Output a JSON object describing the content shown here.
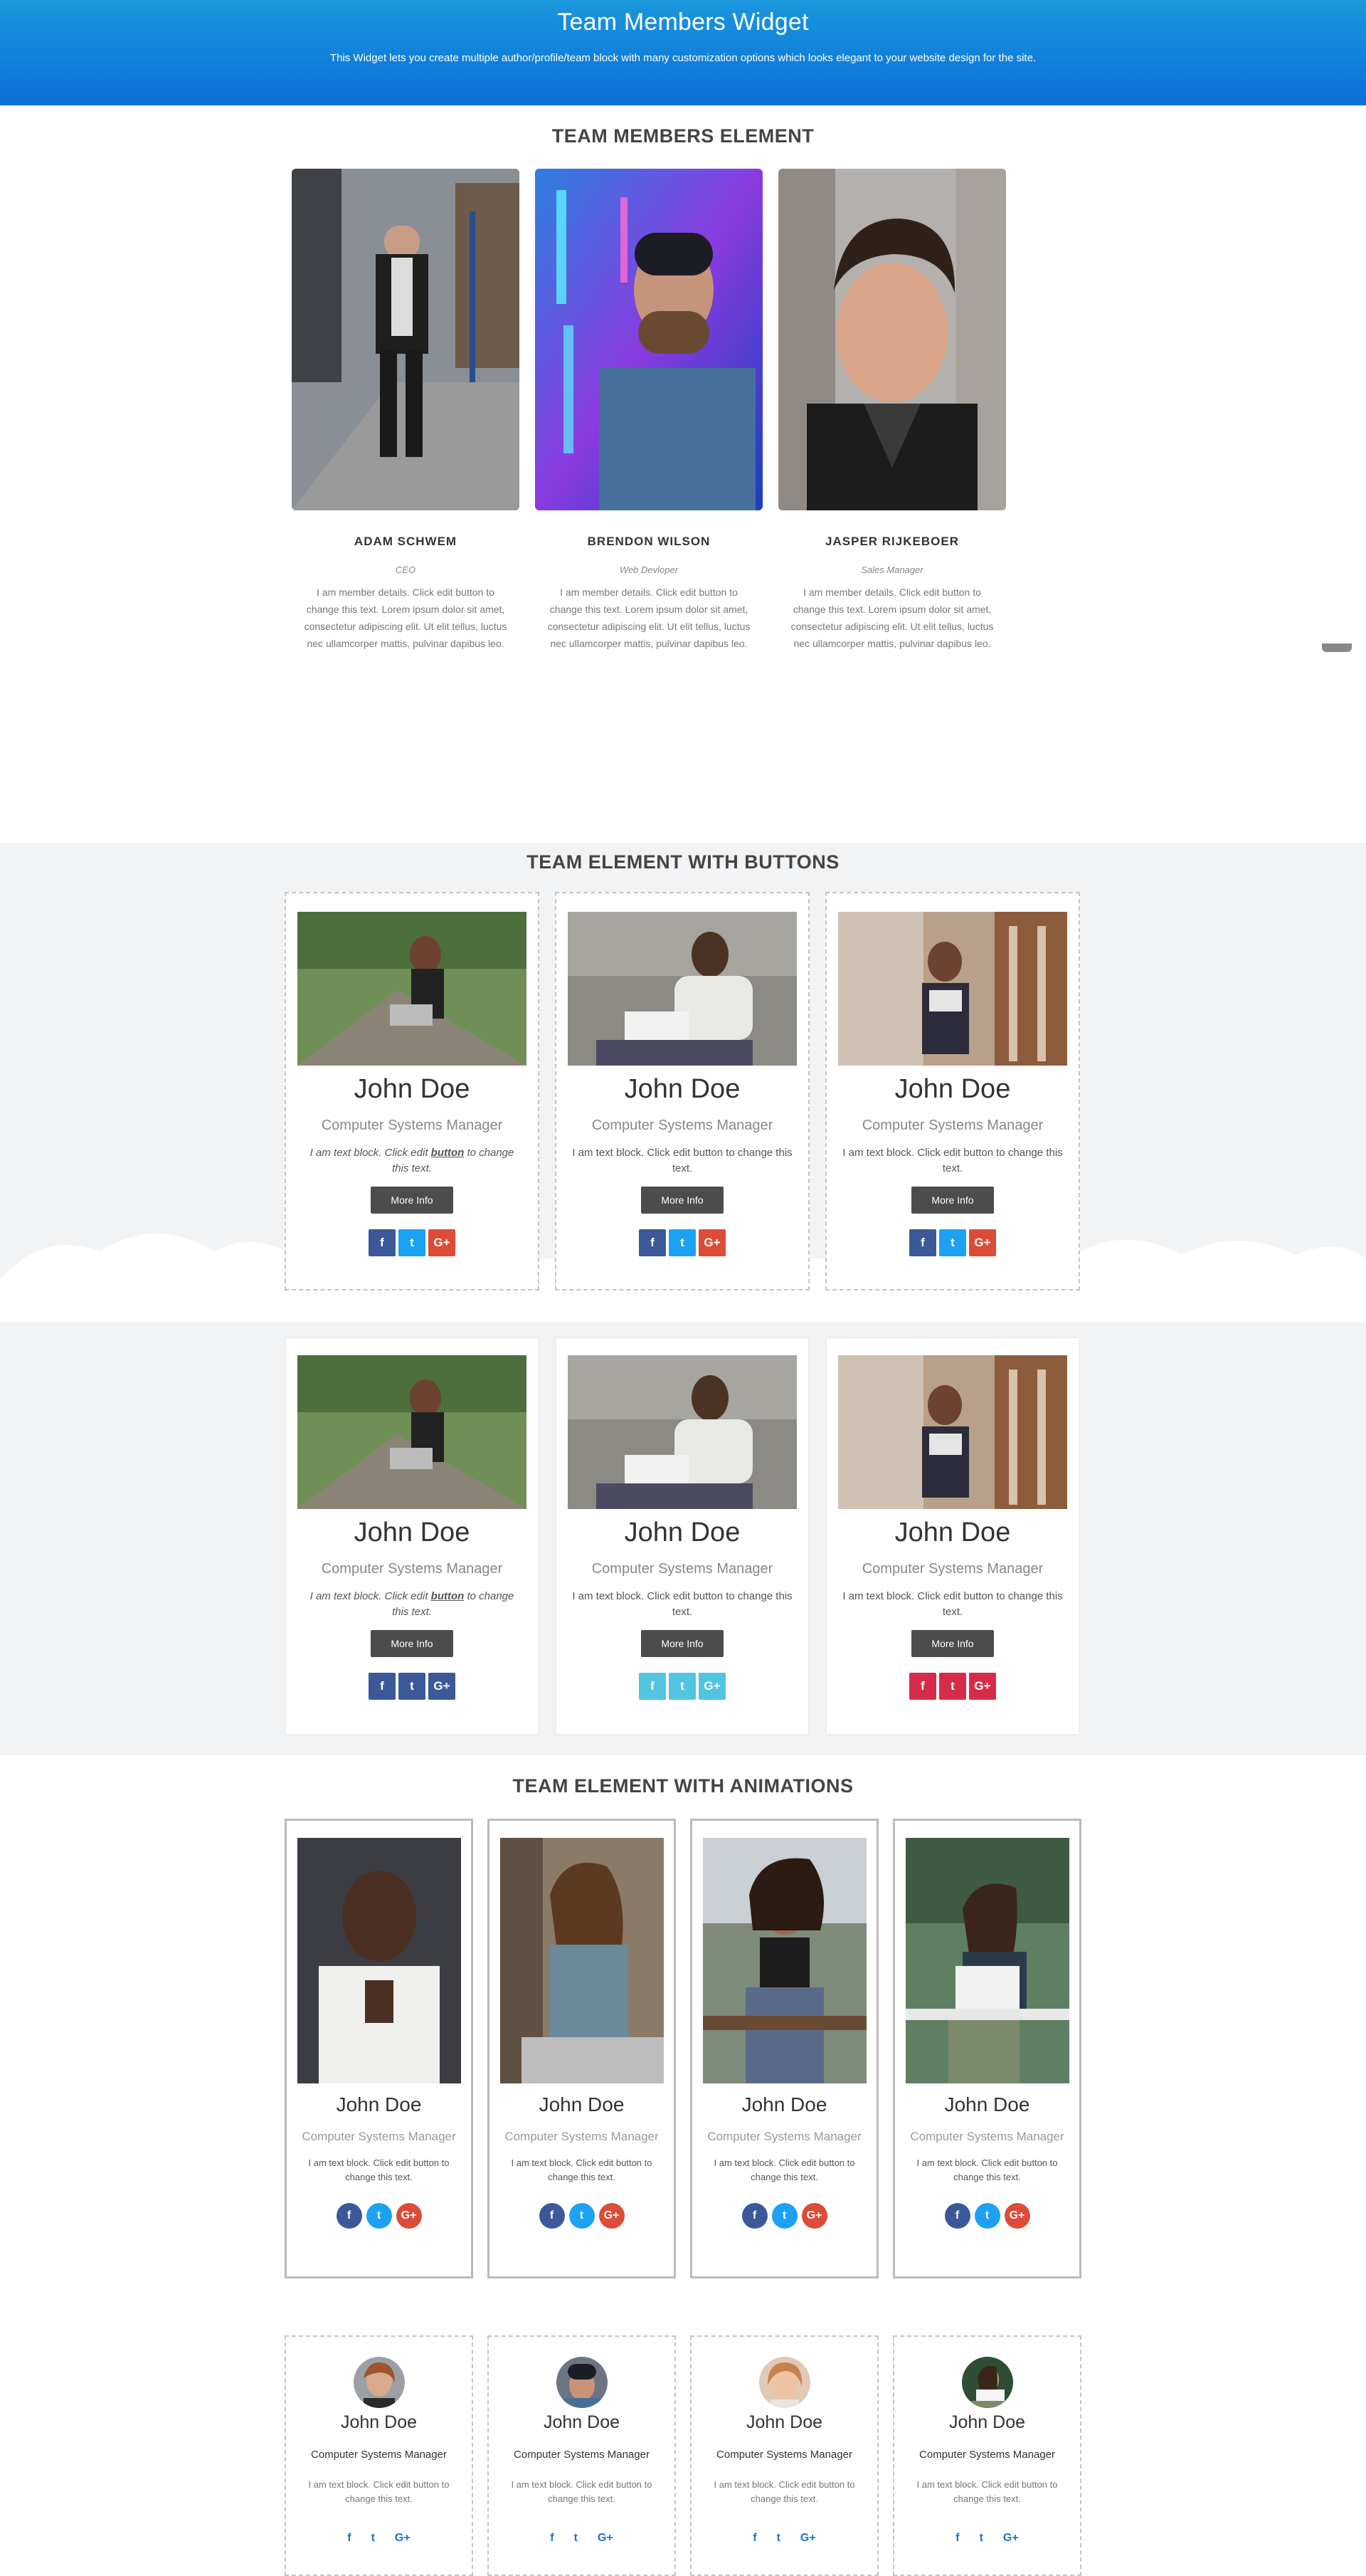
{
  "hero": {
    "title": "Team Members Widget",
    "subtitle": "This Widget lets you create multiple author/profile/team block with many customization options which looks elegant to your website design for the site."
  },
  "section1": {
    "title": "TEAM MEMBERS ELEMENT",
    "members": [
      {
        "name": "ADAM SCHWEM",
        "role": "CEO",
        "desc": "I am member details. Click edit button to change this text. Lorem ipsum dolor sit amet, consectetur adipiscing elit. Ut elit tellus, luctus nec ullamcorper mattis, pulvinar dapibus leo."
      },
      {
        "name": "BRENDON WILSON",
        "role": "Web Devloper",
        "desc": "I am member details. Click edit button to change this text. Lorem ipsum dolor sit amet, consectetur adipiscing elit. Ut elit tellus, luctus nec ullamcorper mattis, pulvinar dapibus leo."
      },
      {
        "name": "JASPER RIJKEBOER",
        "role": "Sales Manager",
        "desc": "I am member details. Click edit button to change this text. Lorem ipsum dolor sit amet, consectetur adipiscing elit. Ut elit tellus, luctus nec ullamcorper mattis, pulvinar dapibus leo."
      }
    ]
  },
  "section2": {
    "title": "TEAM ELEMENT WITH BUTTONS",
    "cards": [
      {
        "name": "John Doe",
        "role": "Computer Systems Manager",
        "text_pre": "I am text block. Click edit ",
        "text_link": "button",
        "text_post": " to change this text.",
        "button": "More Info"
      },
      {
        "name": "John Doe",
        "role": "Computer Systems Manager",
        "text": "I am text block. Click edit button to change this text.",
        "button": "More Info"
      },
      {
        "name": "John Doe",
        "role": "Computer Systems Manager",
        "text": "I am text block. Click edit button to change this text.",
        "button": "More Info"
      }
    ]
  },
  "section3": {
    "cards": [
      {
        "name": "John Doe",
        "role": "Computer Systems Manager",
        "text_pre": "I am text block. Click edit ",
        "text_link": "button",
        "text_post": " to change this text.",
        "button": "More Info",
        "social_color": "#3b5998"
      },
      {
        "name": "John Doe",
        "role": "Computer Systems Manager",
        "text": "I am text block. Click edit button to change this text.",
        "button": "More Info",
        "social_color": "#4fc5e0"
      },
      {
        "name": "John Doe",
        "role": "Computer Systems Manager",
        "text": "I am text block. Click edit button to change this text.",
        "button": "More Info",
        "social_color": "#d62c4a"
      }
    ]
  },
  "section4": {
    "title": "TEAM ELEMENT WITH ANIMATIONS",
    "cards": [
      {
        "name": "John Doe",
        "role": "Computer Systems Manager",
        "text": "I am text block. Click edit button to change this text."
      },
      {
        "name": "John Doe",
        "role": "Computer Systems Manager",
        "text": "I am text block. Click edit button to change this text."
      },
      {
        "name": "John Doe",
        "role": "Computer Systems Manager",
        "text": "I am text block. Click edit button to change this text."
      },
      {
        "name": "John Doe",
        "role": "Computer Systems Manager",
        "text": "I am text block. Click edit button to change this text."
      }
    ],
    "circle_cards": [
      {
        "name": "John Doe",
        "role": "Computer Systems Manager",
        "text": "I am text block. Click edit button to change this text."
      },
      {
        "name": "John Doe",
        "role": "Computer Systems Manager",
        "text": "I am text block. Click edit button to change this text."
      },
      {
        "name": "John Doe",
        "role": "Computer Systems Manager",
        "text": "I am text block. Click edit button to change this text."
      },
      {
        "name": "John Doe",
        "role": "Computer Systems Manager",
        "text": "I am text block. Click edit button to change this text."
      }
    ]
  },
  "social": {
    "facebook": "f",
    "twitter": "t",
    "google": "G+"
  },
  "colors": {
    "hero_top": "#1a97dd",
    "hero_bottom": "#0b6fd8",
    "facebook": "#3b5998",
    "twitter": "#1da1f2",
    "google": "#dd4b39",
    "button": "#4c4c4c",
    "icon_blue": "#1a74c7"
  }
}
